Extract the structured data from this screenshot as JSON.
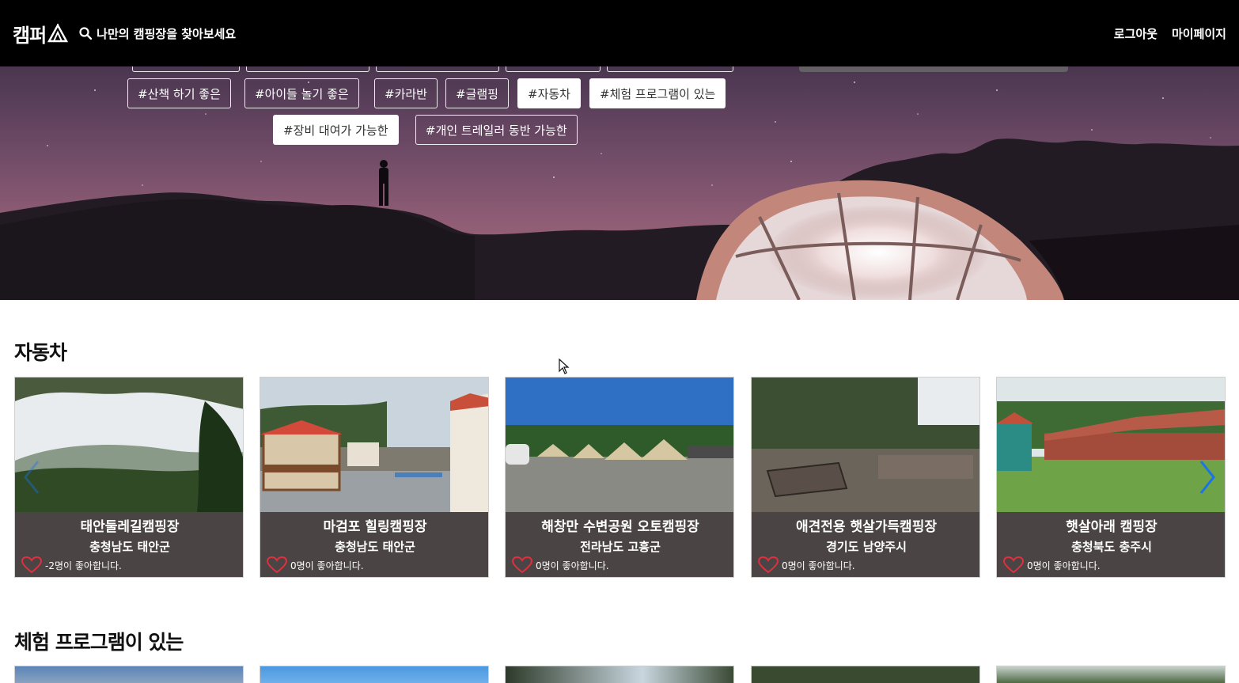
{
  "brand": {
    "logo_text": "캠퍼"
  },
  "header": {
    "search_placeholder": "나만의 캠핑장을 찾아보세요",
    "logout": "로그아웃",
    "mypage": "마이페이지"
  },
  "tags": [
    {
      "label": "#산책 하기 좋은",
      "active": false
    },
    {
      "label": "#아이들 놀기 좋은",
      "active": false
    },
    {
      "label": "#카라반",
      "active": false
    },
    {
      "label": "#글램핑",
      "active": false
    },
    {
      "label": "#자동차",
      "active": true
    },
    {
      "label": "#체험 프로그램이 있는",
      "active": true
    },
    {
      "label": "#장비 대여가 가능한",
      "active": true
    },
    {
      "label": "#개인 트레일러 동반 가능한",
      "active": false
    }
  ],
  "sections": [
    {
      "title": "자동차",
      "cards": [
        {
          "name": "태안둘레길캠핑장",
          "region": "충청남도 태안군",
          "likes": "-2명이 좋아합니다."
        },
        {
          "name": "마검포 힐링캠핑장",
          "region": "충청남도 태안군",
          "likes": "0명이 좋아합니다."
        },
        {
          "name": "해창만 수변공원 오토캠핑장",
          "region": "전라남도 고흥군",
          "likes": "0명이 좋아합니다."
        },
        {
          "name": "애견전용 햇살가득캠핑장",
          "region": "경기도 남양주시",
          "likes": "0명이 좋아합니다."
        },
        {
          "name": "햇살아래 캠핑장",
          "region": "충청북도 충주시",
          "likes": "0명이 좋아합니다."
        }
      ]
    },
    {
      "title": "체험 프로그램이 있는"
    }
  ],
  "icons": {
    "search": "search-icon",
    "logo_tent": "tent-icon",
    "heart": "heart-icon",
    "prev": "chevron-left-icon",
    "next": "chevron-right-icon",
    "cursor": "mouse-cursor-icon"
  },
  "colors": {
    "nav_bg": "#000000",
    "card_info_bg": "#4b4444",
    "heart": "#e03040",
    "arrow": "#1a73e8"
  }
}
